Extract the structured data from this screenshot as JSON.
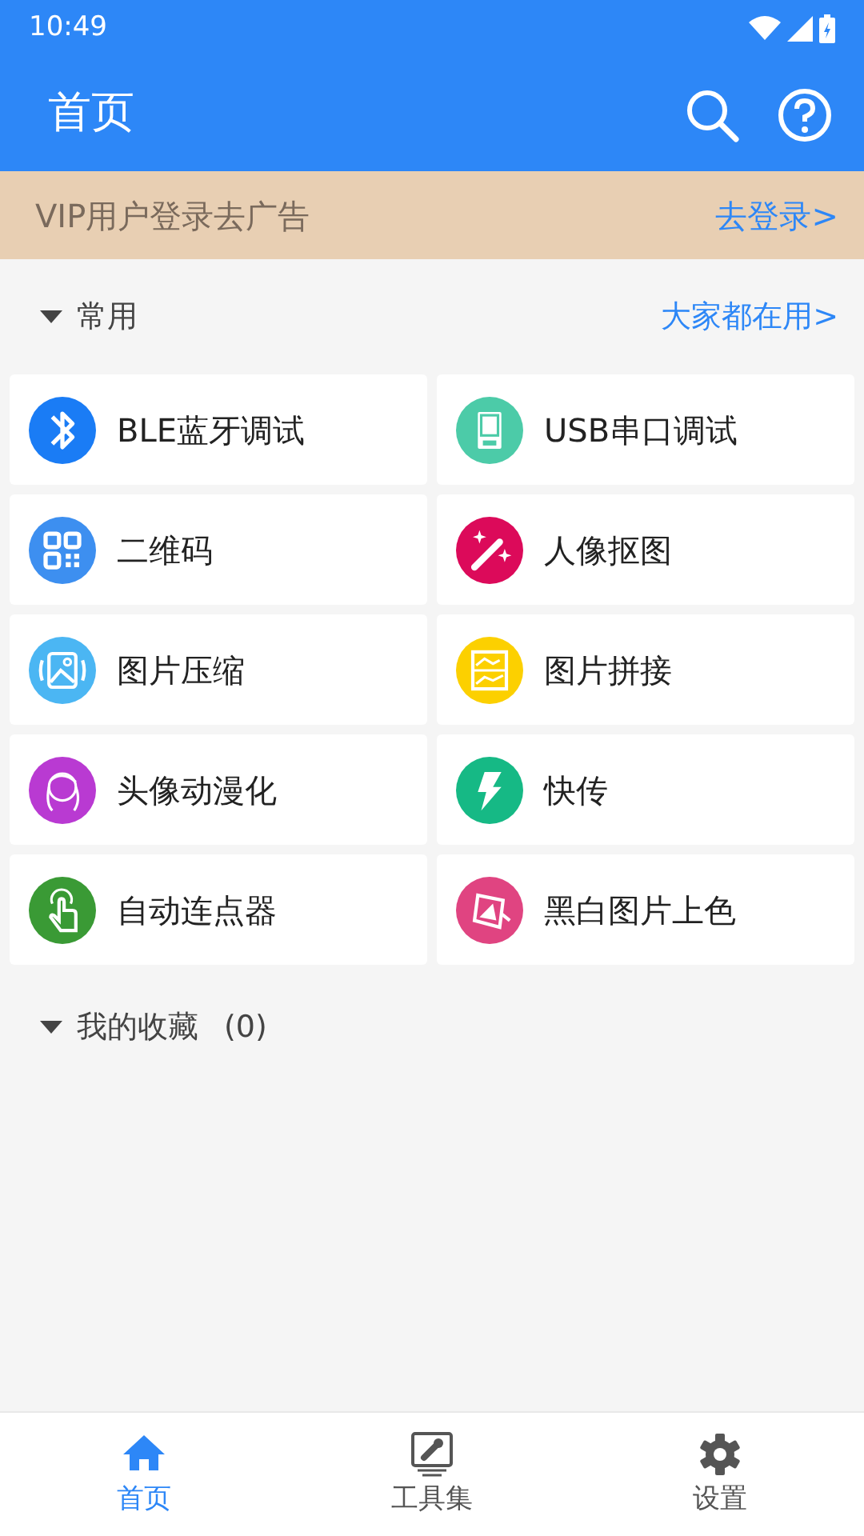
{
  "status_bar": {
    "time": "10:49"
  },
  "app_bar": {
    "title": "首页"
  },
  "banner": {
    "text": "VIP用户登录去广告",
    "link": "去登录>"
  },
  "common_section": {
    "title": "常用",
    "expanded": true,
    "link": "大家都在用>"
  },
  "tools": [
    {
      "label": "BLE蓝牙调试",
      "color": "#1a7cf5"
    },
    {
      "label": "USB串口调试",
      "color": "#4ccba8"
    },
    {
      "label": "二维码",
      "color": "#3d8ff0"
    },
    {
      "label": "人像抠图",
      "color": "#dc0a5a"
    },
    {
      "label": "图片压缩",
      "color": "#4bb6f3"
    },
    {
      "label": "图片拼接",
      "color": "#fcd000"
    },
    {
      "label": "头像动漫化",
      "color": "#b93ad2"
    },
    {
      "label": "快传",
      "color": "#16b985"
    },
    {
      "label": "自动连点器",
      "color": "#3a9a35"
    },
    {
      "label": "黑白图片上色",
      "color": "#e04481"
    }
  ],
  "favorites_section": {
    "title": "我的收藏",
    "count": "(0)",
    "expanded": true
  },
  "bottom_nav": [
    {
      "label": "首页",
      "selected": true
    },
    {
      "label": "工具集",
      "selected": false
    },
    {
      "label": "设置",
      "selected": false
    }
  ]
}
